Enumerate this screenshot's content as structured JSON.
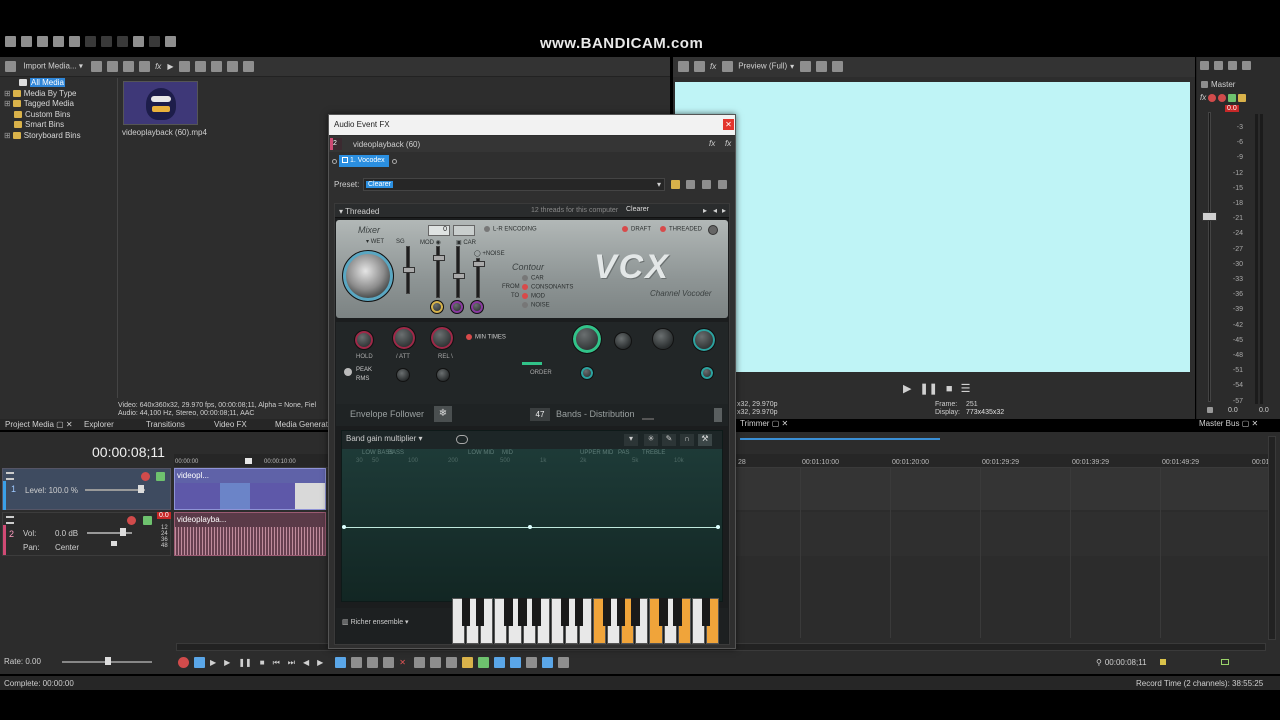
{
  "watermark": "www.BANDICAM.com",
  "media_toolbar": {
    "import_label": "Import Media..."
  },
  "tree": [
    {
      "label": "All Media"
    },
    {
      "label": "Media By Type"
    },
    {
      "label": "Tagged Media"
    },
    {
      "label": "Custom Bins"
    },
    {
      "label": "Smart Bins"
    },
    {
      "label": "Storyboard Bins"
    }
  ],
  "media": {
    "thumb_name": "videoplayback (60).mp4",
    "info_video": "Video: 640x360x32, 29.970 fps, 00:00:08;11, Alpha = None, Fiel",
    "info_audio": "Audio: 44,100 Hz, Stereo, 00:00:08;11, AAC"
  },
  "tabs": [
    "Project Media",
    "Explorer",
    "Transitions",
    "Video FX",
    "Media Generator"
  ],
  "preview": {
    "mode": "Preview (Full)",
    "info1a": "x32, 29.970p",
    "info1b": "x32, 29.970p",
    "frame_label": "Frame:",
    "frame_value": "251",
    "display_label": "Display:",
    "display_value": "773x435x32"
  },
  "master": {
    "title": "Master",
    "peak": "0.0",
    "scale": [
      "3",
      "6",
      "9",
      "12",
      "15",
      "18",
      "21",
      "24",
      "27",
      "30",
      "33",
      "36",
      "39",
      "42",
      "45",
      "48",
      "51",
      "54",
      "57"
    ],
    "bottom_left": "0.0",
    "bottom_right": "0.0",
    "bus_tab": "Master Bus"
  },
  "trimmer": {
    "label": "Trimmer"
  },
  "timeline": {
    "timecode": "00:00:08;11",
    "ruler_small": [
      "00:00:00",
      "00:00:10:00"
    ],
    "ruler": [
      "28",
      "00:01:10:00",
      "00:01:20:00",
      "00:01:29:29",
      "00:01:39:29",
      "00:01:49:29",
      "00:01:5"
    ],
    "video_track": {
      "number": "1",
      "level": "Level: 100.0 %",
      "clip": "videopl..."
    },
    "audio_track": {
      "number": "2",
      "vol_label": "Vol:",
      "vol_value": "0.0 dB",
      "pan_label": "Pan:",
      "pan_value": "Center",
      "peak": "0.0",
      "clip": "videoplayba...",
      "scale": [
        "12",
        "24",
        "36",
        "48"
      ]
    },
    "rate": "Rate: 0.00",
    "end_time": "00:00:08;11"
  },
  "status": {
    "left": "Complete: 00:00:00",
    "right": "Record Time (2 channels): 38:55:25"
  },
  "dialog": {
    "title": "Audio Event FX",
    "track_num": "2",
    "event_name": "videoplayback (60)",
    "plugin_chip": "1. Vocodex",
    "preset_label": "Preset:",
    "preset_value": "Clearer",
    "threaded": "Threaded",
    "threads_info": "12 threads for this computer",
    "preset_right": "Clearer",
    "plugin": {
      "mixer": "Mixer",
      "wet": "WET",
      "sg": "SG",
      "mod": "MOD",
      "car": "CAR",
      "noise_toggle": "+NOISE",
      "lr_encoding": "L-R ENCODING",
      "draft": "DRAFT",
      "threaded": "THREADED",
      "contour": "Contour",
      "from": "FROM",
      "to": "TO",
      "contour_opts": [
        "CAR",
        "CONSONANTS",
        "MOD",
        "NOISE"
      ],
      "logo": "VCX",
      "logo_sub": "Channel Vocoder",
      "mixer_value": "0",
      "knob_labels": [
        "HOLD",
        "ATT",
        "REL"
      ],
      "min_times": "MIN TIMES",
      "peak": "PEAK",
      "rms": "RMS",
      "order": "ORDER",
      "envelope": "Envelope Follower",
      "bands_count": "47",
      "bands_label": "Bands - Distribution",
      "band_mode": "Band gain multiplier",
      "freq_regions": [
        "LOW BASS",
        "BASS",
        "LOW MID",
        "MID",
        "UPPER MID",
        "PAS",
        "TREBLE"
      ],
      "freq_ticks": [
        "30",
        "50",
        "100",
        "200",
        "500",
        "1k",
        "2k",
        "5k",
        "10k"
      ],
      "ensemble": "Richer ensemble"
    }
  },
  "colors": {
    "bg": "#2d2d2d",
    "panel": "#353535",
    "accent": "#3aa0e8",
    "preview": "#bff4f6",
    "plugin_top": "#9aa2a2",
    "plugin_dark": "#1c2222",
    "band_bg": "#173430",
    "red": "#d63a3a"
  }
}
